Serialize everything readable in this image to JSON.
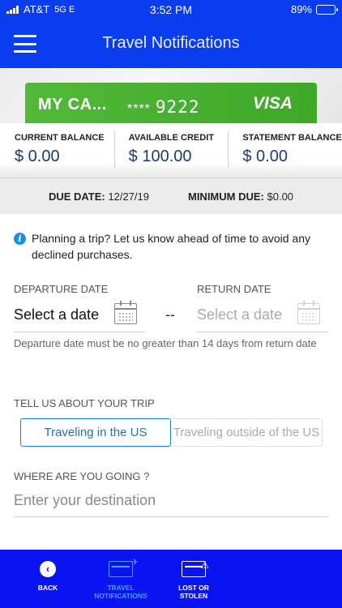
{
  "status_bar": {
    "carrier": "AT&T",
    "network": "5G E",
    "time": "3:52 PM",
    "battery": "89%"
  },
  "header": {
    "title": "Travel Notifications"
  },
  "card": {
    "name": "MY CA...",
    "mask": "****",
    "last4": "9222",
    "brand": "VISA",
    "color": "#4bb233"
  },
  "balances": [
    {
      "label": "CURRENT BALANCE",
      "value": "$ 0.00"
    },
    {
      "label": "AVAILABLE CREDIT",
      "value": "$ 100.00"
    },
    {
      "label": "STATEMENT BALANCE",
      "value": "$ 0.00"
    }
  ],
  "due": {
    "due_label": "DUE DATE:",
    "due_value": "12/27/19",
    "min_label": "MINIMUM DUE:",
    "min_value": "$0.00"
  },
  "info": {
    "text": "Planning a trip? Let us know ahead of time to avoid any declined purchases."
  },
  "dates": {
    "departure_label": "DEPARTURE DATE",
    "departure_value": "Select a date",
    "separator": "--",
    "return_label": "RETURN DATE",
    "return_value": "Select a date",
    "hint": "Departure date must be no greater than 14 days from return date"
  },
  "trip": {
    "label": "TELL US ABOUT YOUR TRIP",
    "options": [
      "Traveling in the US",
      "Traveling outside of the US"
    ],
    "selected": "Traveling in the US"
  },
  "destination": {
    "label": "WHERE ARE YOU GOING ?",
    "placeholder": "Enter your destination",
    "value": ""
  },
  "tabbar": {
    "items": [
      {
        "label": "BACK",
        "icon": "back-icon"
      },
      {
        "label": "TRAVEL NOTIFICATIONS",
        "icon": "travel-card-icon",
        "active": true
      },
      {
        "label": "LOST OR STOLEN",
        "icon": "lost-card-icon"
      }
    ]
  }
}
